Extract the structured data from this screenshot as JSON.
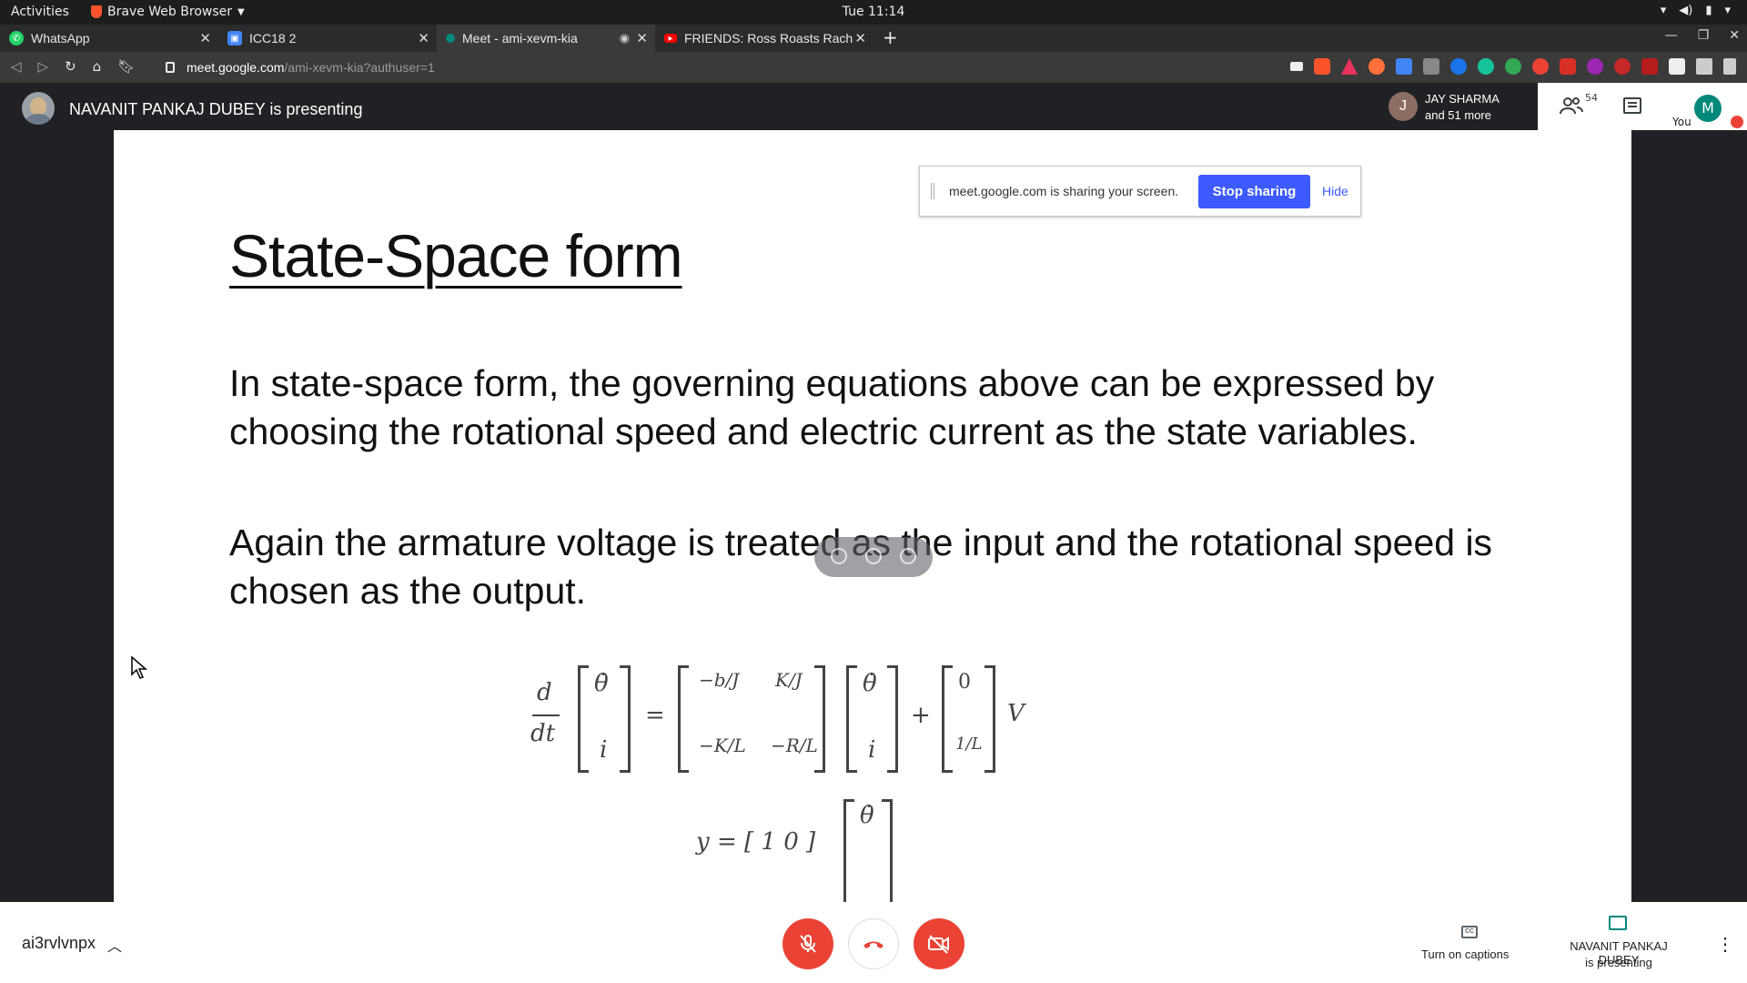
{
  "os_bar": {
    "activities": "Activities",
    "app_name": "Brave Web Browser",
    "clock": "Tue 11:14"
  },
  "tabs": [
    {
      "title": "WhatsApp",
      "icon": "whatsapp-icon",
      "color": "#25d366"
    },
    {
      "title": "ICC18 2",
      "icon": "classroom-icon",
      "color": "#4285f4"
    },
    {
      "title": "Meet - ami-xevm-kia",
      "icon": "meet-icon",
      "color": "#00897b"
    },
    {
      "title": "FRIENDS: Ross Roasts Rach",
      "icon": "youtube-icon",
      "color": "#ff0000"
    }
  ],
  "address": {
    "domain": "meet.google.com",
    "path": "/ami-xevm-kia?authuser=1"
  },
  "meet_header": {
    "presenting_text": "NAVANIT PANKAJ DUBEY is presenting",
    "participant_initial": "J",
    "participant_name": "JAY SHARMA",
    "participant_more": "and 51 more",
    "participant_count": "54",
    "you_initial": "M",
    "you_label": "You"
  },
  "share_banner": {
    "message": "meet.google.com is sharing your screen.",
    "stop_label": "Stop sharing",
    "hide_label": "Hide"
  },
  "slide": {
    "title": "State-Space form",
    "paragraph1": "In state-space form, the governing equations above can be expressed by choosing the rotational speed and electric current as the state variables.",
    "paragraph2": "Again the armature voltage is treated as the input and the rotational speed is chosen as the output.",
    "eq": {
      "d": "d",
      "dt": "dt",
      "theta_dot": "θ̇",
      "i": "i",
      "equals": "=",
      "plus": "+",
      "a11": "−b/J",
      "a12": "K/J",
      "a21": "−K/L",
      "a22": "−R/L",
      "b1": "0",
      "b2": "1/L",
      "V": "V",
      "y_eq": "y = [ 1   0 ]"
    }
  },
  "bottom_bar": {
    "meeting_code": "ai3rvlvnpx",
    "captions_label": "Turn on captions",
    "cc": "CC",
    "presenter_line1": "NAVANIT PANKAJ DUBEY",
    "presenter_line2": "is presenting"
  }
}
